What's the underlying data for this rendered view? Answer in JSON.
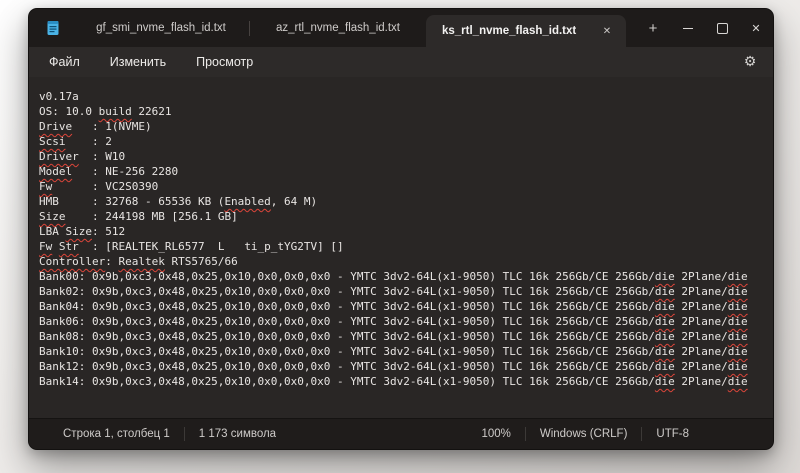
{
  "tab_bar": {
    "tabs": [
      {
        "label": "gf_smi_nvme_flash_id.txt",
        "active": false
      },
      {
        "label": "az_rtl_nvme_flash_id.txt",
        "active": false
      },
      {
        "label": "ks_rtl_nvme_flash_id.txt",
        "active": true
      }
    ]
  },
  "icons": {
    "new_tab": "+",
    "close_tab": "✕",
    "window_close": "✕",
    "gear": "⚙"
  },
  "menu_bar": {
    "items": [
      "Файл",
      "Изменить",
      "Просмотр"
    ]
  },
  "editor": {
    "lines": [
      [
        [
          "v0.17a",
          0
        ]
      ],
      [
        [
          "OS: 10.0 ",
          0
        ],
        [
          "build",
          1
        ],
        [
          " 22621",
          0
        ]
      ],
      [
        [
          "Drive",
          1
        ],
        [
          "   : 1(NVME)",
          0
        ]
      ],
      [
        [
          "Scsi",
          1
        ],
        [
          "    : 2",
          0
        ]
      ],
      [
        [
          "Driver",
          1
        ],
        [
          "  : W10",
          0
        ]
      ],
      [
        [
          "Model",
          1
        ],
        [
          "   : NE-256 2280",
          0
        ]
      ],
      [
        [
          "Fw",
          1
        ],
        [
          "      : VC2S0390",
          0
        ]
      ],
      [
        [
          "HMB     : 32768 - 65536 KB (",
          0
        ],
        [
          "Enabled",
          1
        ],
        [
          ", 64 M)",
          0
        ]
      ],
      [
        [
          "Size",
          1
        ],
        [
          "    : 244198 MB [256.1 GB]",
          0
        ]
      ],
      [
        [
          "LBA ",
          0
        ],
        [
          "Size",
          1
        ],
        [
          ": 512",
          0
        ]
      ],
      [
        [
          "Fw",
          1
        ],
        [
          " ",
          0
        ],
        [
          "Str",
          1
        ],
        [
          "  : [REALTEK_RL6577  L   ti_p_tYG2TV] []",
          0
        ]
      ],
      [
        [
          "Controller",
          1
        ],
        [
          ": ",
          0
        ],
        [
          "Realtek",
          1
        ],
        [
          " RTS5765/66",
          0
        ]
      ],
      [
        [
          "Bank00: 0x9b,0xc3,0x48,0x25,0x10,0x0,0x0,0x0 - YMTC 3dv2-64L(x1-9050) TLC 16k 256Gb/CE 256Gb/",
          0
        ],
        [
          "die",
          1
        ],
        [
          " 2Plane/",
          0
        ],
        [
          "die",
          1
        ]
      ],
      [
        [
          "Bank02: 0x9b,0xc3,0x48,0x25,0x10,0x0,0x0,0x0 - YMTC 3dv2-64L(x1-9050) TLC 16k 256Gb/CE 256Gb/",
          0
        ],
        [
          "die",
          1
        ],
        [
          " 2Plane/",
          0
        ],
        [
          "die",
          1
        ]
      ],
      [
        [
          "Bank04: 0x9b,0xc3,0x48,0x25,0x10,0x0,0x0,0x0 - YMTC 3dv2-64L(x1-9050) TLC 16k 256Gb/CE 256Gb/",
          0
        ],
        [
          "die",
          1
        ],
        [
          " 2Plane/",
          0
        ],
        [
          "die",
          1
        ]
      ],
      [
        [
          "Bank06: 0x9b,0xc3,0x48,0x25,0x10,0x0,0x0,0x0 - YMTC 3dv2-64L(x1-9050) TLC 16k 256Gb/CE 256Gb/",
          0
        ],
        [
          "die",
          1
        ],
        [
          " 2Plane/",
          0
        ],
        [
          "die",
          1
        ]
      ],
      [
        [
          "Bank08: 0x9b,0xc3,0x48,0x25,0x10,0x0,0x0,0x0 - YMTC 3dv2-64L(x1-9050) TLC 16k 256Gb/CE 256Gb/",
          0
        ],
        [
          "die",
          1
        ],
        [
          " 2Plane/",
          0
        ],
        [
          "die",
          1
        ]
      ],
      [
        [
          "Bank10: 0x9b,0xc3,0x48,0x25,0x10,0x0,0x0,0x0 - YMTC 3dv2-64L(x1-9050) TLC 16k 256Gb/CE 256Gb/",
          0
        ],
        [
          "die",
          1
        ],
        [
          " 2Plane/",
          0
        ],
        [
          "die",
          1
        ]
      ],
      [
        [
          "Bank12: 0x9b,0xc3,0x48,0x25,0x10,0x0,0x0,0x0 - YMTC 3dv2-64L(x1-9050) TLC 16k 256Gb/CE 256Gb/",
          0
        ],
        [
          "die",
          1
        ],
        [
          " 2Plane/",
          0
        ],
        [
          "die",
          1
        ]
      ],
      [
        [
          "Bank14: 0x9b,0xc3,0x48,0x25,0x10,0x0,0x0,0x0 - YMTC 3dv2-64L(x1-9050) TLC 16k 256Gb/CE 256Gb/",
          0
        ],
        [
          "die",
          1
        ],
        [
          " 2Plane/",
          0
        ],
        [
          "die",
          1
        ]
      ]
    ]
  },
  "status_bar": {
    "left": [
      "Строка 1, столбец 1",
      "1 173 символа"
    ],
    "right": [
      "100%",
      "Windows (CRLF)",
      "UTF-8"
    ]
  },
  "colors": {
    "titlebar_bg": "#1e1b1a",
    "active_tab_bg": "#2d2a29",
    "editor_bg": "#292625",
    "status_bg": "#1f1c1b",
    "squiggle_red": "#dc453a",
    "notepad_icon_blue": "#4ab3e6"
  }
}
